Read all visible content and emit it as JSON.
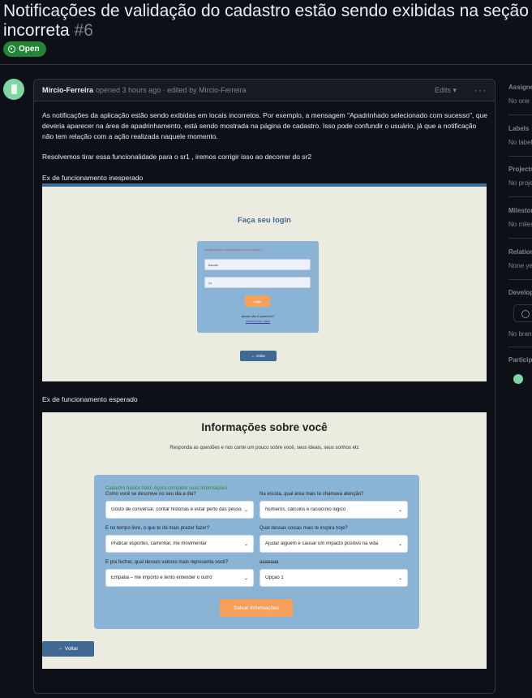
{
  "issue": {
    "title": "Notificações de validação do cadastro estão sendo exibidas na seção incorreta",
    "number": "#6",
    "status": "Open"
  },
  "comment": {
    "author": "Mircio-Ferreira",
    "meta": "opened 3 hours ago · edited by Mircio-Ferreira",
    "edits_label": "Edits",
    "paragraph1": "As notificações da aplicação estão sendo exibidas em locais incorretos. Por exemplo, a mensagem \"Apadrinhado selecionado com sucesso\", que deveria aparecer na área de apadrinhamento, está sendo mostrada na página de cadastro. Isso pode confundir o usuário, já que a notificação não tem relação com a ação realizada naquele momento.",
    "paragraph2": "Resolvemos tirar essa funcionalidade para o sr1 , iremos corrigir isso ao decorrer do sr2",
    "caption1": "Ex de funcionamento inesperado",
    "caption2": "Ex de funcionamento esperado"
  },
  "screenshot1": {
    "heading": "Faça seu login",
    "notification": "Apadrinhado selecionado com sucesso!",
    "username_value": "escola",
    "password_value": "•••",
    "login_button": "Login",
    "no_account": "Ainda não é padrinho?",
    "register_link": "Inscreva-se aqui!",
    "back_button": "← Voltar"
  },
  "screenshot2": {
    "heading": "Informações sobre você",
    "subheading": "Responda as questões e nos conte um pouco sobre você, seus ideais, seus sonhos etc",
    "success": "Cadastro básico feito! Agora complete suas informações.",
    "questions": [
      {
        "label": "Como você se descreve no seu dia a dia?",
        "value": "Gosto de conversar, contar histórias e estar perto das pessoas"
      },
      {
        "label": "Na escola, qual área mais te chamava atenção?",
        "value": "Números, cálculos e raciocínio lógico"
      },
      {
        "label": "E no tempo livre, o que te dá mais prazer fazer?",
        "value": "Praticar esportes, caminhar, me movimentar"
      },
      {
        "label": "Qual dessas coisas mais te inspira hoje?",
        "value": "Ajudar alguém e causar um impacto positivo na vida"
      },
      {
        "label": "E pra fechar, qual desses valores mais representa você?",
        "value": "Empatia – me importo e tento entender o outro"
      },
      {
        "label": "aaaaaaa",
        "value": "Opção 1"
      }
    ],
    "save_button": "Salvar Informações",
    "back_button": "← Voltar"
  },
  "sidebar": {
    "sections": [
      {
        "title": "Assignees",
        "value": "No one"
      },
      {
        "title": "Labels",
        "value": "No labels"
      },
      {
        "title": "Projects",
        "value": "No projects"
      },
      {
        "title": "Milestone",
        "value": "No milestone"
      },
      {
        "title": "Relationships",
        "value": "None yet"
      },
      {
        "title": "Development",
        "value": "No branches"
      },
      {
        "title": "Participants",
        "value": ""
      }
    ]
  },
  "colors": {
    "open_badge": "#238636",
    "background": "#0d1117",
    "panel_blue": "#8ab4d6",
    "accent_orange": "#f7a05a"
  }
}
